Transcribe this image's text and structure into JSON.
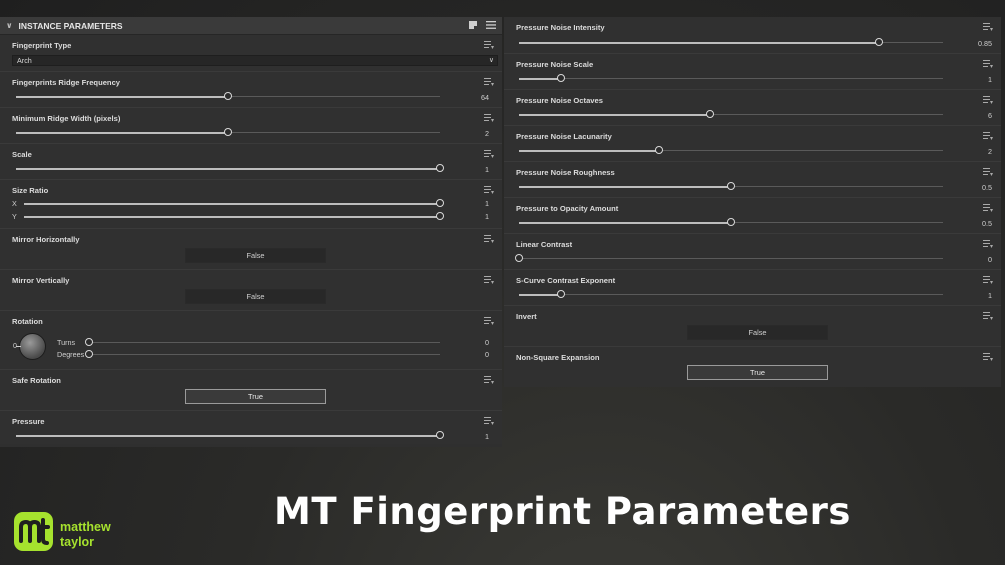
{
  "header": {
    "title": "INSTANCE PARAMETERS"
  },
  "left": {
    "fingerprint_type": {
      "label": "Fingerprint Type",
      "value": "Arch"
    },
    "ridge_frequency": {
      "label": "Fingerprints Ridge Frequency",
      "value": "64",
      "fraction": 0.5
    },
    "min_ridge_width": {
      "label": "Minimum Ridge Width (pixels)",
      "value": "2",
      "fraction": 0.5
    },
    "scale": {
      "label": "Scale",
      "value": "1",
      "fraction": 1.0
    },
    "size_ratio": {
      "label": "Size Ratio",
      "x_label": "X",
      "x_value": "1",
      "x_fraction": 1.0,
      "y_label": "Y",
      "y_value": "1",
      "y_fraction": 1.0
    },
    "mirror_h": {
      "label": "Mirror Horizontally",
      "value": "False"
    },
    "mirror_v": {
      "label": "Mirror Vertically",
      "value": "False"
    },
    "rotation": {
      "label": "Rotation",
      "dial_value": "0",
      "turns_label": "Turns",
      "turns_value": "0",
      "turns_fraction": 0.0,
      "degrees_label": "Degrees",
      "degrees_value": "0",
      "degrees_fraction": 0.0
    },
    "safe_rotation": {
      "label": "Safe Rotation",
      "value": "True"
    },
    "pressure": {
      "label": "Pressure",
      "value": "1",
      "fraction": 1.0
    }
  },
  "right": {
    "noise_intensity": {
      "label": "Pressure Noise Intensity",
      "value": "0.85",
      "fraction": 0.85
    },
    "noise_scale": {
      "label": "Pressure Noise Scale",
      "value": "1",
      "fraction": 0.1
    },
    "noise_octaves": {
      "label": "Pressure Noise Octaves",
      "value": "6",
      "fraction": 0.45
    },
    "noise_lacunarity": {
      "label": "Pressure Noise Lacunarity",
      "value": "2",
      "fraction": 0.33
    },
    "noise_roughness": {
      "label": "Pressure Noise Roughness",
      "value": "0.5",
      "fraction": 0.5
    },
    "opacity_amount": {
      "label": "Pressure to Opacity Amount",
      "value": "0.5",
      "fraction": 0.5
    },
    "linear_contrast": {
      "label": "Linear Contrast",
      "value": "0",
      "fraction": 0.0
    },
    "scurve": {
      "label": "S-Curve Contrast Exponent",
      "value": "1",
      "fraction": 0.1
    },
    "invert": {
      "label": "Invert",
      "value": "False"
    },
    "non_square": {
      "label": "Non-Square Expansion",
      "value": "True"
    }
  },
  "footer": {
    "title": "MT Fingerprint Parameters",
    "brand_line1": "matthew",
    "brand_line2": "taylor",
    "brand_color": "#a6e22e"
  },
  "icons": {
    "param_menu": "param-menu-icon",
    "collapse": "chevron-down-icon",
    "header_1": "preset-icon",
    "header_2": "menu-lines-icon"
  }
}
